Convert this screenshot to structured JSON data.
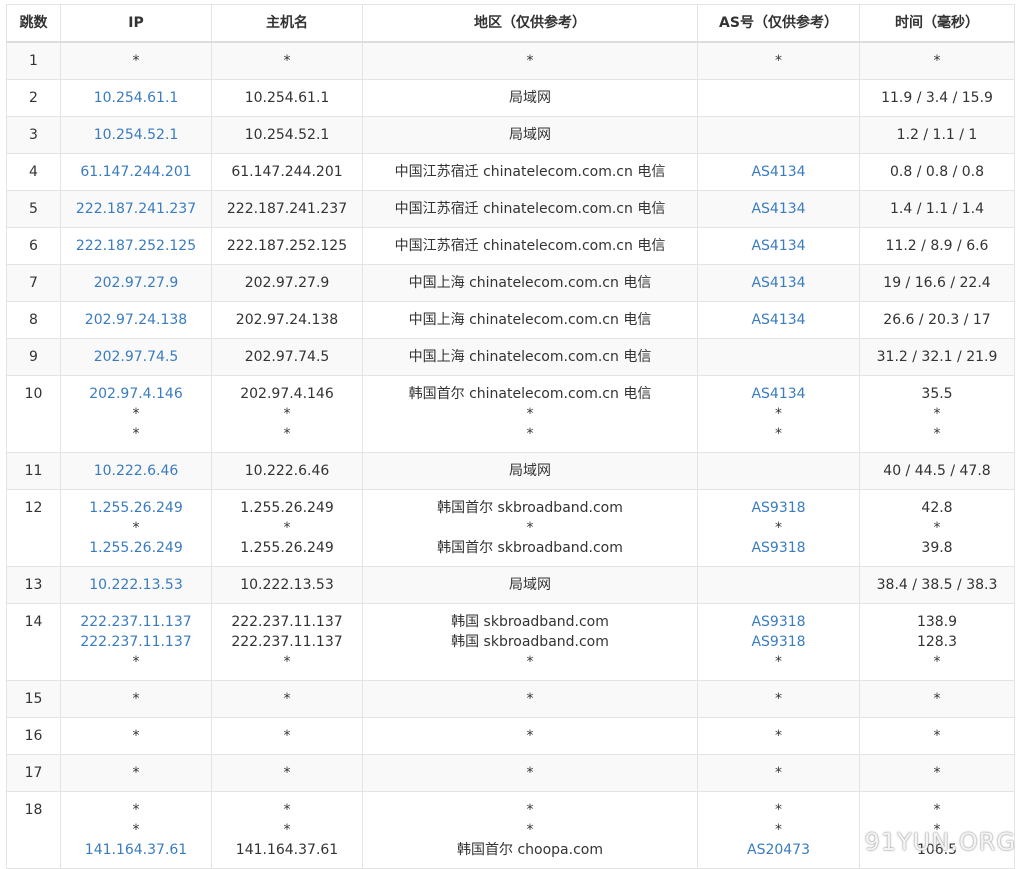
{
  "columns": [
    "跳数",
    "IP",
    "主机名",
    "地区（仅供参考）",
    "AS号（仅供参考）",
    "时间（毫秒）"
  ],
  "rows": [
    {
      "hop": "1",
      "lines": [
        {
          "ip": "*",
          "host": "*",
          "region": "*",
          "as": "*",
          "time": "*"
        }
      ]
    },
    {
      "hop": "2",
      "lines": [
        {
          "ip": "10.254.61.1",
          "host": "10.254.61.1",
          "region": "局域网",
          "as": "",
          "time": "11.9 / 3.4 / 15.9"
        }
      ]
    },
    {
      "hop": "3",
      "lines": [
        {
          "ip": "10.254.52.1",
          "host": "10.254.52.1",
          "region": "局域网",
          "as": "",
          "time": "1.2 / 1.1 / 1"
        }
      ]
    },
    {
      "hop": "4",
      "lines": [
        {
          "ip": "61.147.244.201",
          "host": "61.147.244.201",
          "region": "中国江苏宿迁 chinatelecom.com.cn 电信",
          "as": "AS4134",
          "time": "0.8 / 0.8 / 0.8"
        }
      ]
    },
    {
      "hop": "5",
      "lines": [
        {
          "ip": "222.187.241.237",
          "host": "222.187.241.237",
          "region": "中国江苏宿迁 chinatelecom.com.cn 电信",
          "as": "AS4134",
          "time": "1.4 / 1.1 / 1.4"
        }
      ]
    },
    {
      "hop": "6",
      "lines": [
        {
          "ip": "222.187.252.125",
          "host": "222.187.252.125",
          "region": "中国江苏宿迁 chinatelecom.com.cn 电信",
          "as": "AS4134",
          "time": "11.2 / 8.9 / 6.6"
        }
      ]
    },
    {
      "hop": "7",
      "lines": [
        {
          "ip": "202.97.27.9",
          "host": "202.97.27.9",
          "region": "中国上海 chinatelecom.com.cn 电信",
          "as": "AS4134",
          "time": "19 / 16.6 / 22.4"
        }
      ]
    },
    {
      "hop": "8",
      "lines": [
        {
          "ip": "202.97.24.138",
          "host": "202.97.24.138",
          "region": "中国上海 chinatelecom.com.cn 电信",
          "as": "AS4134",
          "time": "26.6 / 20.3 / 17"
        }
      ]
    },
    {
      "hop": "9",
      "lines": [
        {
          "ip": "202.97.74.5",
          "host": "202.97.74.5",
          "region": "中国上海 chinatelecom.com.cn 电信",
          "as": "",
          "time": "31.2 / 32.1 / 21.9"
        }
      ]
    },
    {
      "hop": "10",
      "lines": [
        {
          "ip": "202.97.4.146",
          "host": "202.97.4.146",
          "region": "韩国首尔 chinatelecom.com.cn 电信",
          "as": "AS4134",
          "time": "35.5"
        },
        {
          "ip": "*",
          "host": "*",
          "region": "*",
          "as": "*",
          "time": "*"
        },
        {
          "ip": "*",
          "host": "*",
          "region": "*",
          "as": "*",
          "time": "*"
        }
      ]
    },
    {
      "hop": "11",
      "lines": [
        {
          "ip": "10.222.6.46",
          "host": "10.222.6.46",
          "region": "局域网",
          "as": "",
          "time": "40 / 44.5 / 47.8"
        }
      ]
    },
    {
      "hop": "12",
      "lines": [
        {
          "ip": "1.255.26.249",
          "host": "1.255.26.249",
          "region": "韩国首尔 skbroadband.com",
          "as": "AS9318",
          "time": "42.8"
        },
        {
          "ip": "*",
          "host": "*",
          "region": "*",
          "as": "*",
          "time": "*"
        },
        {
          "ip": "1.255.26.249",
          "host": "1.255.26.249",
          "region": "韩国首尔 skbroadband.com",
          "as": "AS9318",
          "time": "39.8"
        }
      ]
    },
    {
      "hop": "13",
      "lines": [
        {
          "ip": "10.222.13.53",
          "host": "10.222.13.53",
          "region": "局域网",
          "as": "",
          "time": "38.4 / 38.5 / 38.3"
        }
      ]
    },
    {
      "hop": "14",
      "lines": [
        {
          "ip": "222.237.11.137",
          "host": "222.237.11.137",
          "region": "韩国 skbroadband.com",
          "as": "AS9318",
          "time": "138.9"
        },
        {
          "ip": "222.237.11.137",
          "host": "222.237.11.137",
          "region": "韩国 skbroadband.com",
          "as": "AS9318",
          "time": "128.3"
        },
        {
          "ip": "*",
          "host": "*",
          "region": "*",
          "as": "*",
          "time": "*"
        }
      ]
    },
    {
      "hop": "15",
      "lines": [
        {
          "ip": "*",
          "host": "*",
          "region": "*",
          "as": "*",
          "time": "*"
        }
      ]
    },
    {
      "hop": "16",
      "lines": [
        {
          "ip": "*",
          "host": "*",
          "region": "*",
          "as": "*",
          "time": "*"
        }
      ]
    },
    {
      "hop": "17",
      "lines": [
        {
          "ip": "*",
          "host": "*",
          "region": "*",
          "as": "*",
          "time": "*"
        }
      ]
    },
    {
      "hop": "18",
      "lines": [
        {
          "ip": "*",
          "host": "*",
          "region": "*",
          "as": "*",
          "time": "*"
        },
        {
          "ip": "*",
          "host": "*",
          "region": "*",
          "as": "*",
          "time": "*"
        },
        {
          "ip": "141.164.37.61",
          "host": "141.164.37.61",
          "region": "韩国首尔 choopa.com",
          "as": "AS20473",
          "time": "106.5"
        }
      ]
    }
  ],
  "watermark": "91YUN.ORG",
  "colors": {
    "link": "#3a7cbf",
    "text": "#333333",
    "border": "#e4e4e4",
    "stripe": "#f9f9f9"
  }
}
